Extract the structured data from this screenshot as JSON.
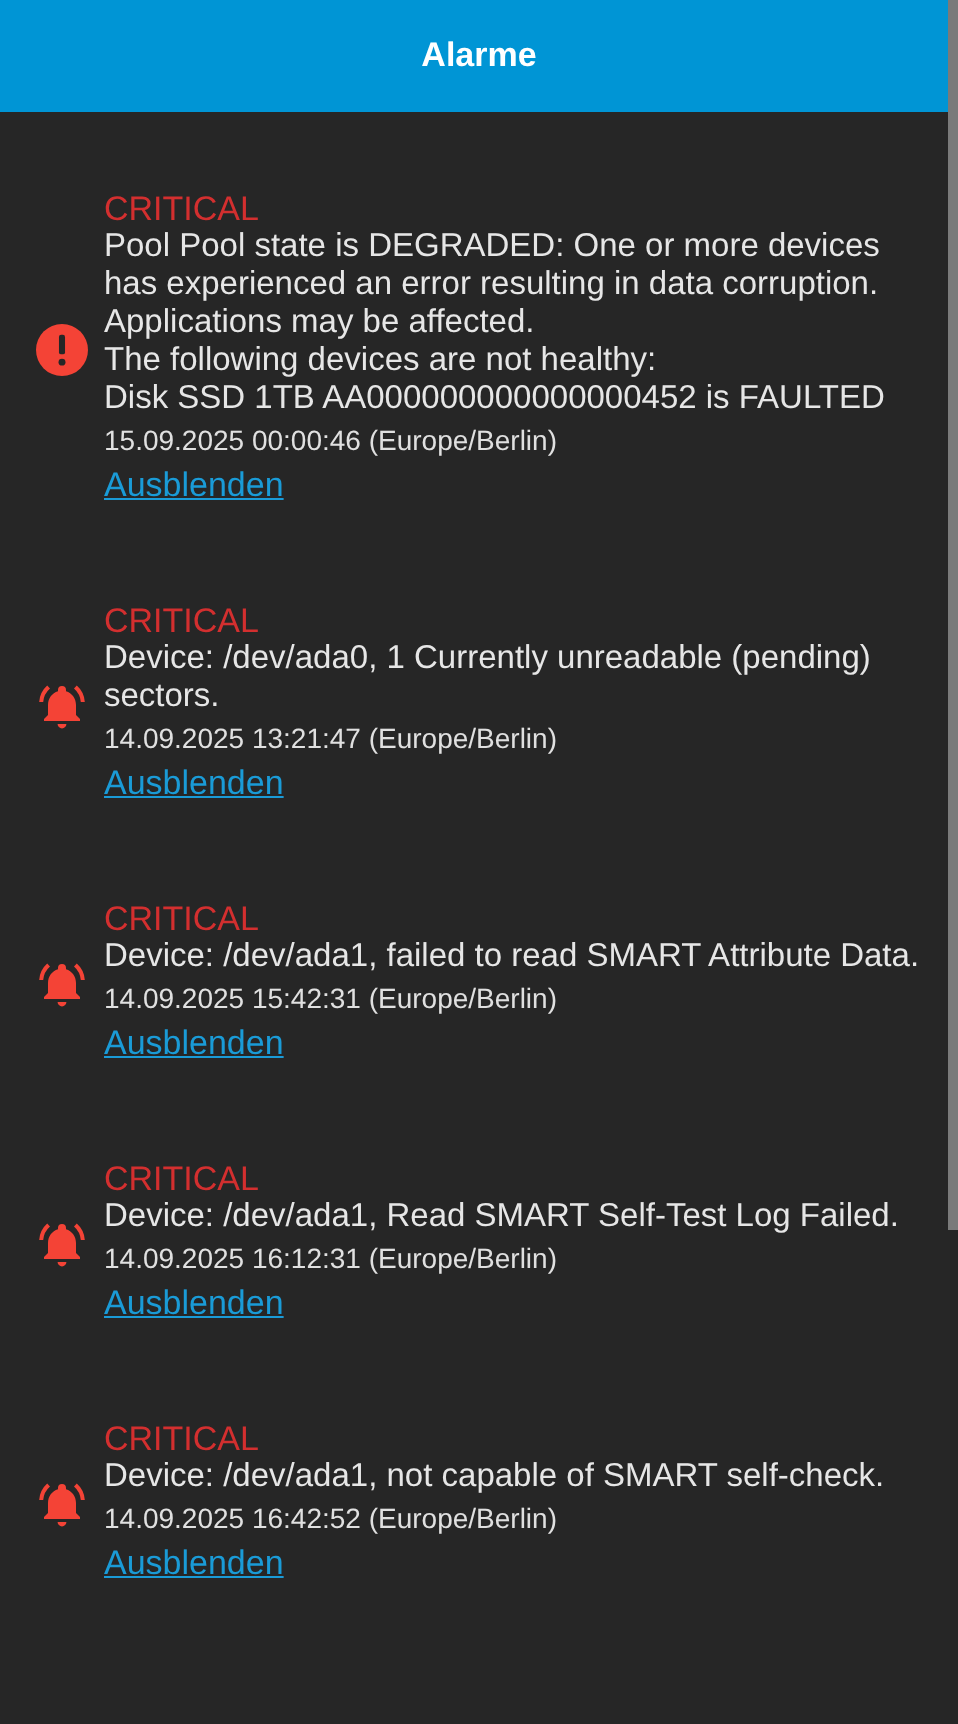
{
  "header": {
    "title": "Alarme"
  },
  "alarms": [
    {
      "kind": "error",
      "severity": "CRITICAL",
      "message": "Pool Pool state is DEGRADED: One or more devices has experienced an error resulting in data corruption. Applications may be affected.\nThe following devices are not healthy:\nDisk SSD 1TB AA000000000000000452 is FAULTED",
      "time": "15.09.2025 00:00:46 (Europe/Berlin)",
      "action": "Ausblenden"
    },
    {
      "kind": "bell",
      "severity": "CRITICAL",
      "message": "Device: /dev/ada0, 1 Currently unreadable (pending) sectors.",
      "time": "14.09.2025 13:21:47 (Europe/Berlin)",
      "action": "Ausblenden"
    },
    {
      "kind": "bell",
      "severity": "CRITICAL",
      "message": "Device: /dev/ada1, failed to read SMART Attribute Data.",
      "time": "14.09.2025 15:42:31 (Europe/Berlin)",
      "action": "Ausblenden"
    },
    {
      "kind": "bell",
      "severity": "CRITICAL",
      "message": "Device: /dev/ada1, Read SMART Self-Test Log Failed.",
      "time": "14.09.2025 16:12:31 (Europe/Berlin)",
      "action": "Ausblenden"
    },
    {
      "kind": "bell",
      "severity": "CRITICAL",
      "message": "Device: /dev/ada1, not capable of SMART self-check.",
      "time": "14.09.2025 16:42:52 (Europe/Berlin)",
      "action": "Ausblenden"
    }
  ]
}
